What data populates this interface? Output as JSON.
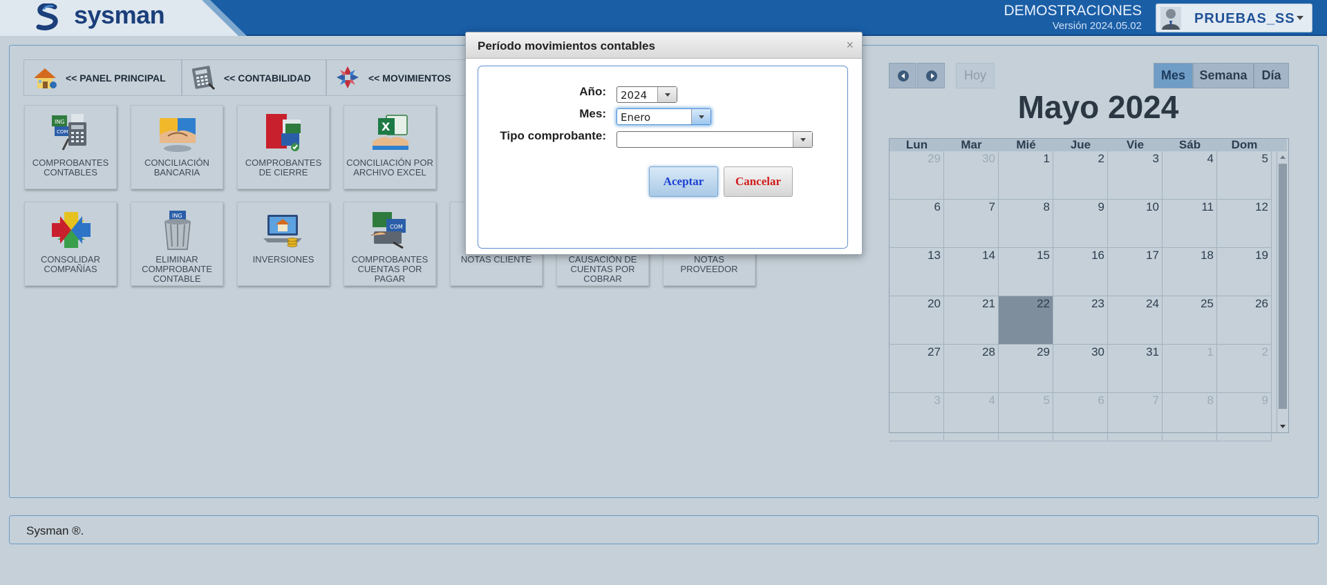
{
  "header": {
    "logo_text": "sysman",
    "org_name": "DEMOSTRACIONES",
    "version": "Versión 2024.05.02",
    "user_name": "PRUEBAS_SS"
  },
  "breadcrumbs": [
    {
      "label": "<< PANEL PRINCIPAL",
      "icon": "house-icon"
    },
    {
      "label": "<< CONTABILIDAD",
      "icon": "calculator-icon"
    },
    {
      "label": "<< MOVIMIENTOS",
      "icon": "arrows-cycle-icon"
    }
  ],
  "tiles": [
    {
      "label": "COMPROBANTES CONTABLES",
      "icon": "receipts-calculator-icon"
    },
    {
      "label": "CONCILIACIÓN BANCARIA",
      "icon": "handshake-icon"
    },
    {
      "label": "COMPROBANTES DE CIERRE",
      "icon": "closing-documents-icon"
    },
    {
      "label": "CONCILIACIÓN POR ARCHIVO EXCEL",
      "icon": "excel-icon"
    },
    {
      "label": "CONSOLIDAR COMPAÑÍAS",
      "icon": "consolidate-arrows-icon"
    },
    {
      "label": "ELIMINAR COMPROBANTE CONTABLE",
      "icon": "trash-bin-icon"
    },
    {
      "label": "INVERSIONES",
      "icon": "investments-laptop-icon"
    },
    {
      "label": "COMPROBANTES CUENTAS POR PAGAR",
      "icon": "payables-icon"
    },
    {
      "label": "NOTAS CLIENTE",
      "icon": "notes-icon"
    },
    {
      "label": "CAUSACIÓN DE CUENTAS POR COBRAR",
      "icon": "receivables-icon"
    },
    {
      "label": "NOTAS PROVEEDOR",
      "icon": "notes-icon"
    }
  ],
  "calendar": {
    "today_label": "Hoy",
    "views": [
      "Mes",
      "Semana",
      "Día"
    ],
    "active_view": "Mes",
    "title": "Mayo 2024",
    "weekdays": [
      "Lun",
      "Mar",
      "Mié",
      "Jue",
      "Vie",
      "Sáb",
      "Dom"
    ],
    "weeks": [
      [
        {
          "d": "29",
          "o": true
        },
        {
          "d": "30",
          "o": true
        },
        {
          "d": "1"
        },
        {
          "d": "2"
        },
        {
          "d": "3"
        },
        {
          "d": "4"
        },
        {
          "d": "5"
        }
      ],
      [
        {
          "d": "6"
        },
        {
          "d": "7"
        },
        {
          "d": "8"
        },
        {
          "d": "9"
        },
        {
          "d": "10"
        },
        {
          "d": "11"
        },
        {
          "d": "12"
        }
      ],
      [
        {
          "d": "13"
        },
        {
          "d": "14"
        },
        {
          "d": "15"
        },
        {
          "d": "16"
        },
        {
          "d": "17"
        },
        {
          "d": "18"
        },
        {
          "d": "19"
        }
      ],
      [
        {
          "d": "20"
        },
        {
          "d": "21"
        },
        {
          "d": "22",
          "today": true
        },
        {
          "d": "23"
        },
        {
          "d": "24"
        },
        {
          "d": "25"
        },
        {
          "d": "26"
        }
      ],
      [
        {
          "d": "27"
        },
        {
          "d": "28"
        },
        {
          "d": "29"
        },
        {
          "d": "30"
        },
        {
          "d": "31"
        },
        {
          "d": "1",
          "o": true
        },
        {
          "d": "2",
          "o": true
        }
      ],
      [
        {
          "d": "3",
          "o": true
        },
        {
          "d": "4",
          "o": true
        },
        {
          "d": "5",
          "o": true
        },
        {
          "d": "6",
          "o": true
        },
        {
          "d": "7",
          "o": true
        },
        {
          "d": "8",
          "o": true
        },
        {
          "d": "9",
          "o": true
        }
      ]
    ]
  },
  "footer": {
    "text": "Sysman ®."
  },
  "dialog": {
    "title": "Período movimientos contables",
    "close_label": "×",
    "year_label": "Año:",
    "year_value": "2024",
    "month_label": "Mes:",
    "month_value": "Enero",
    "type_label": "Tipo comprobante:",
    "type_value": "",
    "accept_label": "Aceptar",
    "cancel_label": "Cancelar"
  }
}
